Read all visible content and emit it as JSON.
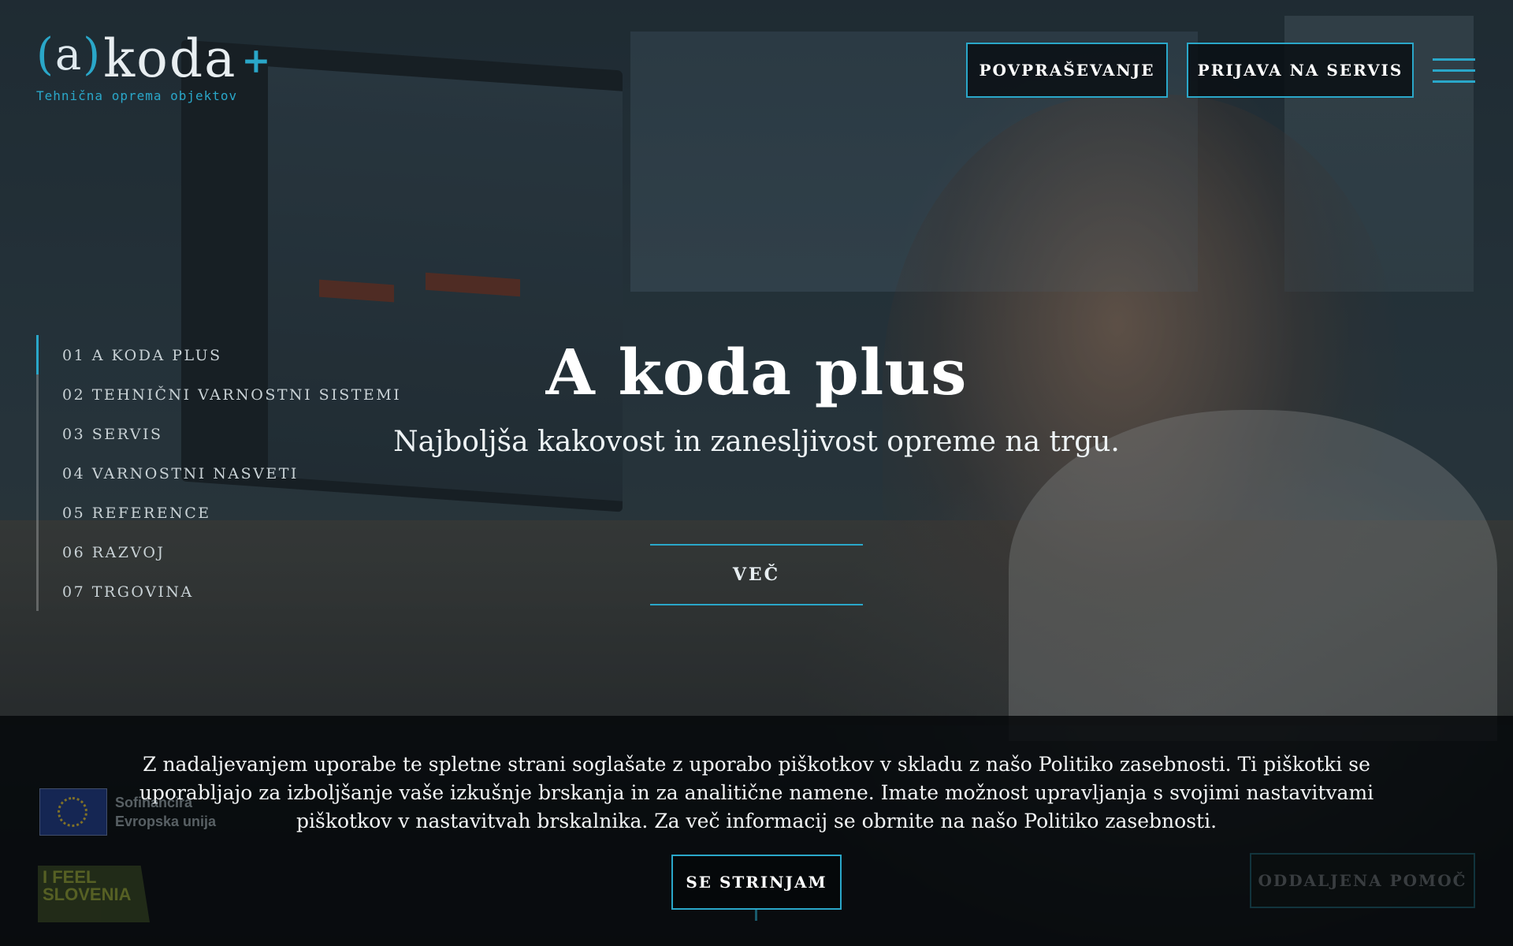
{
  "header": {
    "logo": {
      "mark_paren_open": "(",
      "mark_letter": "a",
      "mark_paren_close": ")",
      "wordmark": "koda",
      "plus": "+",
      "tagline": "Tehnična oprema objektov"
    },
    "buttons": {
      "inquiry": "POVPRAŠEVANJE",
      "service": "PRIJAVA NA SERVIS"
    },
    "menu_icon": "hamburger-menu-icon"
  },
  "sidenav": {
    "items": [
      {
        "label": "01 A KODA PLUS",
        "active": true
      },
      {
        "label": "02 TEHNIČNI VARNOSTNI SISTEMI"
      },
      {
        "label": "03 SERVIS"
      },
      {
        "label": "04 VARNOSTNI NASVETI"
      },
      {
        "label": "05 REFERENCE"
      },
      {
        "label": "06 RAZVOJ"
      },
      {
        "label": "07 TRGOVINA"
      }
    ]
  },
  "hero": {
    "title": "A koda plus",
    "subtitle": "Najboljša kakovost in zanesljivost opreme na trgu.",
    "more": "VEČ"
  },
  "badges": {
    "eu_line1": "Sofinancira",
    "eu_line2": "Evropska unija",
    "ifeel_line1": "I FEEL",
    "ifeel_line2": "SLOVENIA"
  },
  "cookie": {
    "text": "Z nadaljevanjem uporabe te spletne strani soglašate z uporabo piškotkov v skladu z našo Politiko zasebnosti. Ti piškotki se uporabljajo za izboljšanje vaše izkušnje brskanja in za analitične namene. Imate možnost upravljanja s svojimi nastavitvami piškotkov v nastavitvah brskalnika. Za več informacij se obrnite na našo Politiko zasebnosti.",
    "accept": "SE STRINJAM"
  },
  "remote_help": "ODDALJENA POMOČ",
  "colors": {
    "accent": "#2aa7c9",
    "cookie_bg": "#06080a"
  }
}
